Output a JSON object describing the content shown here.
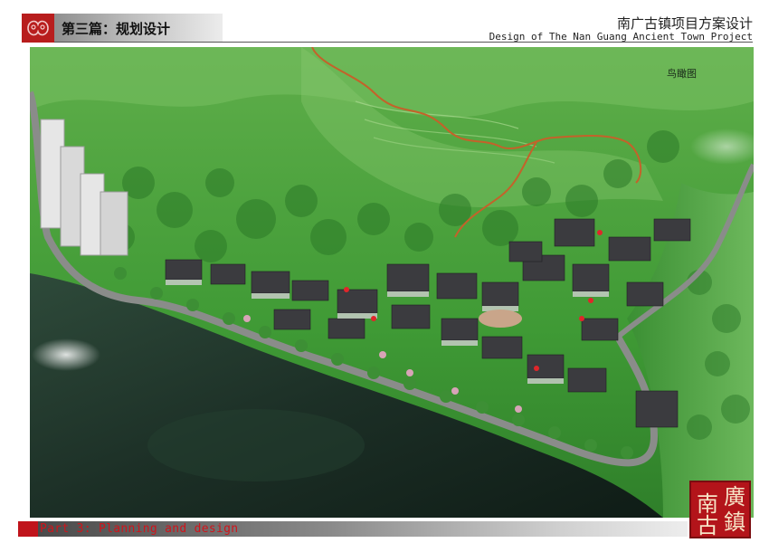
{
  "header": {
    "chapter_title": "第三篇：规划设计",
    "project_title_cn": "南广古镇项目方案设计",
    "project_title_en": "Design of The Nan Guang Ancient Town Project"
  },
  "image": {
    "view_label": "鸟瞰图"
  },
  "footer": {
    "part_label": "Part 3: Planning and design"
  },
  "seal": {
    "characters": [
      "南",
      "廣",
      "古",
      "鎮"
    ]
  },
  "colors": {
    "accent_red": "#c0141b",
    "mountain_green": "#3f9a35",
    "water_dark": "#1c2f26"
  }
}
